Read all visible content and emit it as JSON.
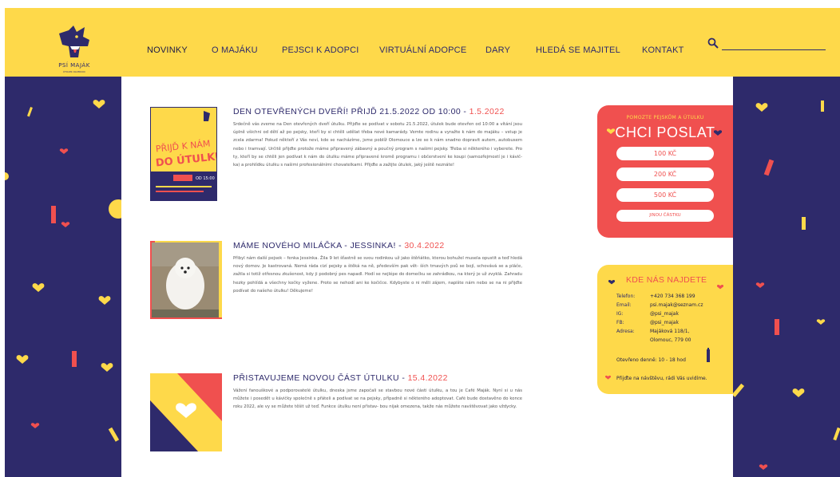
{
  "header": {
    "logo": {
      "name": "PSÍ MAJÁK",
      "tagline": "ÚTULEK OLOMOUC"
    },
    "nav": [
      {
        "label": "NOVINKY"
      },
      {
        "label": "O MAJÁKU"
      },
      {
        "label": "PEJSCI K ADOPCI"
      },
      {
        "label": "VIRTUÁLNÍ ADOPCE"
      },
      {
        "label": "DARY"
      },
      {
        "label": "HLEDÁ SE MAJITEL"
      },
      {
        "label": "KONTAKT"
      }
    ],
    "search": {
      "placeholder": ""
    }
  },
  "posts": [
    {
      "title": "DEN OTEVŘENÝCH DVEŘÍ! PŘIJĎ 21.5.2022 OD 10:00",
      "date": "1.5.2022",
      "text": "Srdečně vás zveme na Den otevřených dveří útulku. Přijďte se podívat v sobotu 21.5.2022, útulek bude otevřen od 10:00 a vítání jsou úplně všichni od dětí až po pejsky, kteří by si chtěli udělat třeba nové kamarády. Vemte rodinu a vyražte k nám do majáku – vstup je zcela zdarma! Pokud někteří z Vás neví, kde se nacházíme, jsme poblíž Olomouce a lze se k nám snadno dopravit autem, autobusem nebo i tramvají. Určitě přijďte protože máme připravený zábavný a poučný program s našimi pejsky. Třeba si některého i vyberete. Pro ty, kteří by se chtěli jen podívat k nám do útulku máme připravené kromě programu i občerstvení ke koupi (samozřejmostí je i kávič- ka) a prohlídku útulku s našimi profesionálními chovatelkami. Přijďte a zažijte útulek, jaký ještě neznáte!",
      "poster": {
        "top": "PŘIJĎ K NÁM",
        "bottom": "DO ÚTULKU",
        "time": "OD 15:00"
      }
    },
    {
      "title": "MÁME NOVÉHO MILÁČKA - JESSINKA!",
      "date": "30.4.2022",
      "text": "Přibyl nám další pejsek – fenka Jessinka. Žila 9 let šťastně se svou rodinkou už jako štěňátko, kterou bohužel musela opustit a teď hledá nový domov. Je kastrovaná. Nemá ráda cizí pejsky a štěká na ně, především pak vět- ších tmavých psů se bojí, schovává se a pláče, zažila si totiž otřesnou zkušenost, kdy ji podobný pes napadl. Hodí se nejlépe do domečku se zahrádkou, na který je už zvyklá. Zahradu hezky pohlídá a všechny kočky vyžene. Proto se nehodí ani ke kočičce. Kdybyste o ni měli zájem, napište nám nebo se na ni přijďte podívat do našeho útulku! Děkujeme!"
    },
    {
      "title": "PŘISTAVUJEME NOVOU ČÁST ÚTULKU",
      "date": "15.4.2022",
      "text": "Vážení fanouškové a podporovatelé útulku, dneska jsme započali se stavbou nové části útulku, a tou je Café Maják. Nyní si u nás můžete i posedět u kávičky společně s přáteli a podívat se na pejsky, případně si některého adoptovat. Café bude dostavěno do konce roku 2022, ale vy se můžete těšit už teď. Funkce útulku není přistav- bou nijak omezena, takže nás můžete navštěvovat jako vždycky."
    }
  ],
  "donate": {
    "subtitle": "POMOZTE PEJSKŮM A ÚTULKU",
    "title": "CHCI POSLAT",
    "buttons": [
      "100 KČ",
      "200 KČ",
      "500 KČ",
      "JINOU ČÁSTKU"
    ]
  },
  "contact": {
    "title": "KDE NÁS NAJDETE",
    "rows": [
      {
        "label": "Telefon:",
        "value": "+420 734 368 199"
      },
      {
        "label": "Email:",
        "value": "psi.majak@seznam.cz"
      },
      {
        "label": "IG:",
        "value": "@psi_majak"
      },
      {
        "label": "FB:",
        "value": "@psi_majak"
      },
      {
        "label": "Adresa:",
        "value": "Majáková 118/1,"
      },
      {
        "label": "",
        "value": "Olomouc, 779 00"
      }
    ],
    "hours": "Otevřeno denně: 10 - 18 hod",
    "visit": "Přijďte na návštěvu, rádi Vás uvidíme."
  },
  "colors": {
    "yellow": "#fed94a",
    "navy": "#2e2a6b",
    "coral": "#f0504f",
    "white": "#ffffff"
  }
}
